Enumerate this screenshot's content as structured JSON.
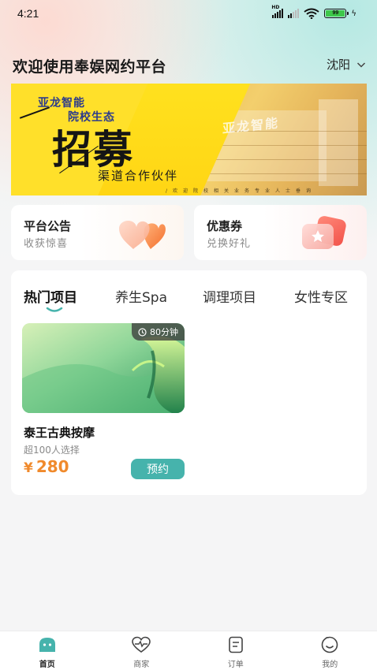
{
  "status_bar": {
    "time": "4:21",
    "signal_label": "HD",
    "battery_level": "99"
  },
  "header": {
    "title": "欢迎使用奉娱网约平台",
    "city": "沈阳"
  },
  "banner": {
    "line1": "亚龙智能",
    "line2": "院校生态",
    "headline": "招募",
    "subline": "渠道合作伙伴",
    "footer": "/欢迎院校相关业务专业人士垂询",
    "building_sign": "亚龙智能"
  },
  "cards": [
    {
      "title": "平台公告",
      "subtitle": "收获惊喜",
      "icon": "heart-art-icon"
    },
    {
      "title": "优惠券",
      "subtitle": "兑换好礼",
      "icon": "star-coupon-icon"
    }
  ],
  "tabs": [
    {
      "label": "热门项目",
      "active": true
    },
    {
      "label": "养生Spa",
      "active": false
    },
    {
      "label": "调理项目",
      "active": false
    },
    {
      "label": "女性专区",
      "active": false
    }
  ],
  "services": [
    {
      "name": "泰王古典按摩",
      "meta": "超100人选择",
      "currency": "¥",
      "price": "280",
      "duration": "80分钟",
      "cta": "预约"
    }
  ],
  "nav": [
    {
      "label": "首页",
      "icon": "home-icon",
      "active": true
    },
    {
      "label": "商家",
      "icon": "merchant-heart-icon",
      "active": false
    },
    {
      "label": "订单",
      "icon": "order-icon",
      "active": false
    },
    {
      "label": "我的",
      "icon": "profile-smile-icon",
      "active": false
    }
  ],
  "colors": {
    "accent": "#46b3ac",
    "price": "#f08a2c",
    "banner_yellow": "#ffe02a"
  }
}
